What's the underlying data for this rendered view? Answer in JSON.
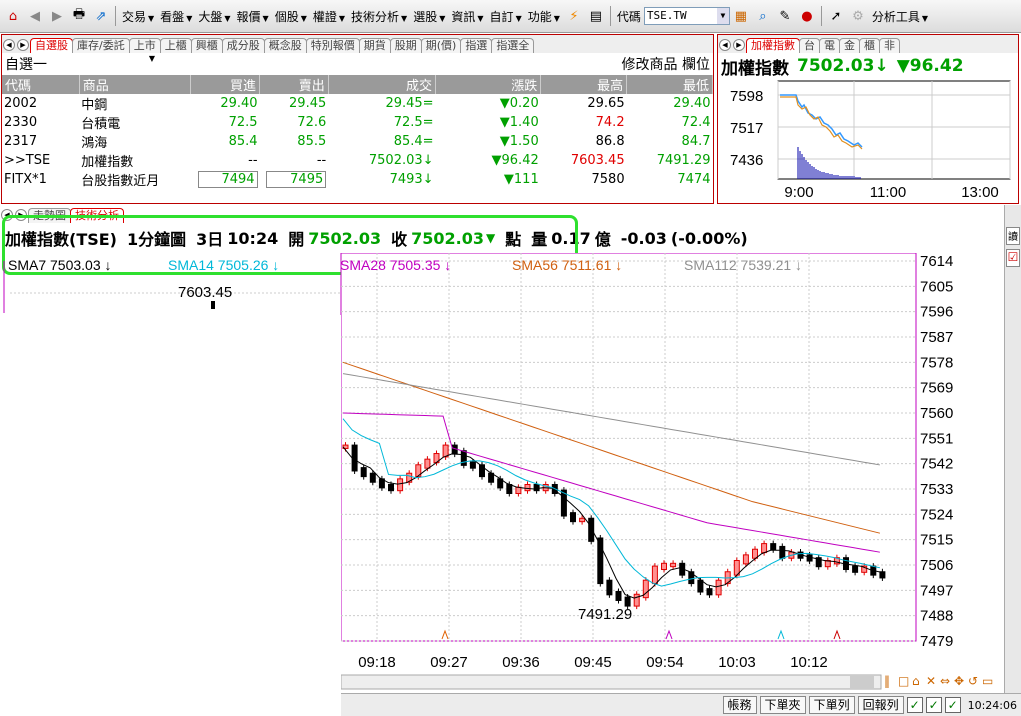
{
  "toolbar": {
    "menus": [
      "交易",
      "看盤",
      "大盤",
      "報價",
      "個股",
      "權證",
      "技術分析",
      "選股",
      "資訊",
      "自訂",
      "功能"
    ],
    "code_label": "代碼",
    "code_value": "TSE.TW",
    "tools_label": "分析工具"
  },
  "watch": {
    "tabs": [
      "自選股",
      "庫存/委託",
      "上市",
      "上櫃",
      "興櫃",
      "成分股",
      "概念股",
      "特別報價",
      "期貨",
      "股期",
      "期(價)",
      "指選",
      "指選全"
    ],
    "group": "自選一",
    "edit_label": "修改商品",
    "field_label": "欄位",
    "headers": [
      "代碼",
      "商品",
      "買進",
      "賣出",
      "成交",
      "漲跌",
      "最高",
      "最低"
    ],
    "rows": [
      {
        "code": "2002",
        "name": "中鋼",
        "bid": "29.40",
        "ask": "29.45",
        "last": "29.45",
        "mark": "=",
        "chg": "0.20",
        "high": "29.65",
        "low": "29.40"
      },
      {
        "code": "2330",
        "name": "台積電",
        "bid": "72.5",
        "ask": "72.6",
        "last": "72.5",
        "mark": "=",
        "chg": "1.40",
        "high": "74.2",
        "low": "72.4"
      },
      {
        "code": "2317",
        "name": "鴻海",
        "bid": "85.4",
        "ask": "85.5",
        "last": "85.4",
        "mark": "=",
        "chg": "1.50",
        "high": "86.8",
        "low": "84.7"
      },
      {
        "code": ">>TSE",
        "name": "加權指數",
        "bid": "--",
        "ask": "--",
        "last": "7502.03",
        "mark": "↓",
        "chg": "96.42",
        "high": "7603.45",
        "low": "7491.29"
      },
      {
        "code": "FITX*1",
        "name": "台股指數近月",
        "bid": "7494",
        "ask": "7495",
        "last": "7493",
        "mark": "↓",
        "chg": "111",
        "high": "7580",
        "low": "7474"
      }
    ]
  },
  "mini": {
    "tabs": [
      "加權指數",
      "台",
      "電",
      "金",
      "櫃",
      "非"
    ],
    "name": "加權指數",
    "price": "7502.03",
    "chg": "▼96.42",
    "yticks": [
      "7598",
      "7517",
      "7436"
    ],
    "xticks": [
      "9:00",
      "11:00",
      "13:00"
    ]
  },
  "chart": {
    "tabs": [
      "走勢圖",
      "技術分析"
    ],
    "header": {
      "name": "加權指數(TSE)",
      "period": "1分鐘圖",
      "day": "3日",
      "time": "10:24",
      "open_label": "開",
      "open": "7502.03",
      "close_label": "收",
      "close": "7502.03",
      "unit": "點",
      "vol_label": "量",
      "vol": "0.17",
      "vol_unit": "億",
      "chg": "-0.03",
      "pct": "(-0.00%)"
    },
    "sma": [
      {
        "label": "SMA7",
        "value": "7503.03",
        "color": "#000000"
      },
      {
        "label": "SMA14",
        "value": "7505.26",
        "color": "#00b8d8"
      },
      {
        "label": "SMA28",
        "value": "7505.35",
        "color": "#c000c0"
      },
      {
        "label": "SMA56",
        "value": "7511.61",
        "color": "#d06010"
      },
      {
        "label": "SMA112",
        "value": "7539.21",
        "color": "#909090"
      }
    ],
    "yticks": [
      "7614",
      "7605",
      "7596",
      "7587",
      "7578",
      "7569",
      "7560",
      "7551",
      "7542",
      "7533",
      "7524",
      "7515",
      "7506",
      "7497",
      "7488",
      "7479"
    ],
    "xticks": [
      "09:18",
      "09:27",
      "09:36",
      "09:45",
      "09:54",
      "10:03",
      "10:12"
    ],
    "high_label": "7603.45",
    "low_label": "7491.29"
  },
  "chart_data": {
    "type": "line",
    "ylim": [
      7479,
      7614
    ],
    "series_candles": "intraday 1-min"
  },
  "status": {
    "buttons": [
      "帳務",
      "下單夾",
      "下單列",
      "回報列"
    ],
    "clock": "10:24:06"
  },
  "colors": {
    "up": "#e00000",
    "down": "#00a000",
    "accent": "#d00000",
    "frame": "#b00000"
  }
}
